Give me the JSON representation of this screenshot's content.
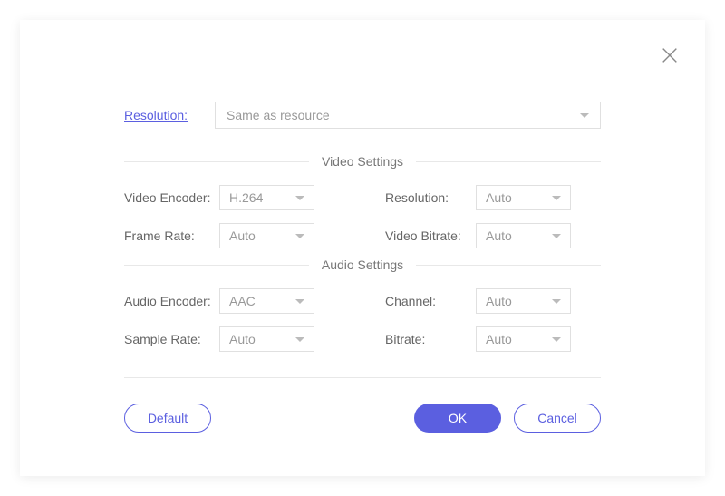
{
  "top": {
    "label": "Resolution:",
    "value": "Same as resource"
  },
  "sections": {
    "video": {
      "title": "Video Settings",
      "encoder_label": "Video Encoder:",
      "encoder_value": "H.264",
      "framerate_label": "Frame Rate:",
      "framerate_value": "Auto",
      "resolution_label": "Resolution:",
      "resolution_value": "Auto",
      "bitrate_label": "Video Bitrate:",
      "bitrate_value": "Auto"
    },
    "audio": {
      "title": "Audio Settings",
      "encoder_label": "Audio Encoder:",
      "encoder_value": "AAC",
      "samplerate_label": "Sample Rate:",
      "samplerate_value": "Auto",
      "channel_label": "Channel:",
      "channel_value": "Auto",
      "bitrate_label": "Bitrate:",
      "bitrate_value": "Auto"
    }
  },
  "buttons": {
    "default": "Default",
    "ok": "OK",
    "cancel": "Cancel"
  }
}
